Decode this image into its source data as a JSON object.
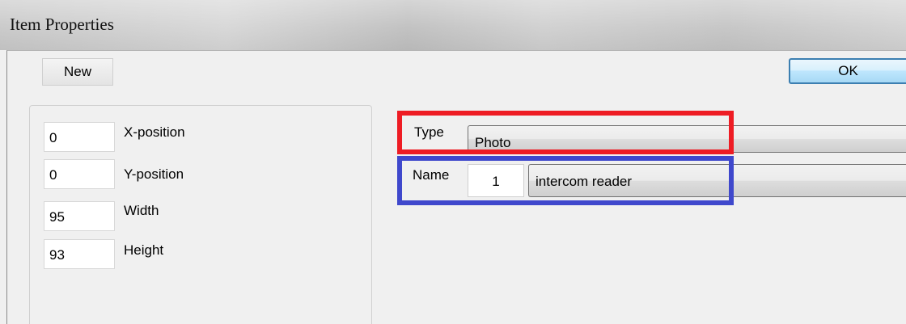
{
  "window": {
    "title": "Item Properties"
  },
  "toolbar": {
    "new_label": "New",
    "ok_label": "OK"
  },
  "geometry_panel": {
    "x_position": {
      "value": "0",
      "label": "X-position"
    },
    "y_position": {
      "value": "0",
      "label": "Y-position"
    },
    "width": {
      "value": "95",
      "label": "Width"
    },
    "height": {
      "value": "93",
      "label": "Height"
    }
  },
  "item": {
    "type_label": "Type",
    "type_value": "Photo",
    "name_label": "Name",
    "name_number": "1",
    "name_value": "intercom reader"
  },
  "highlights": {
    "type_box_color": "#ee1c24",
    "name_box_color": "#3f48cc"
  }
}
